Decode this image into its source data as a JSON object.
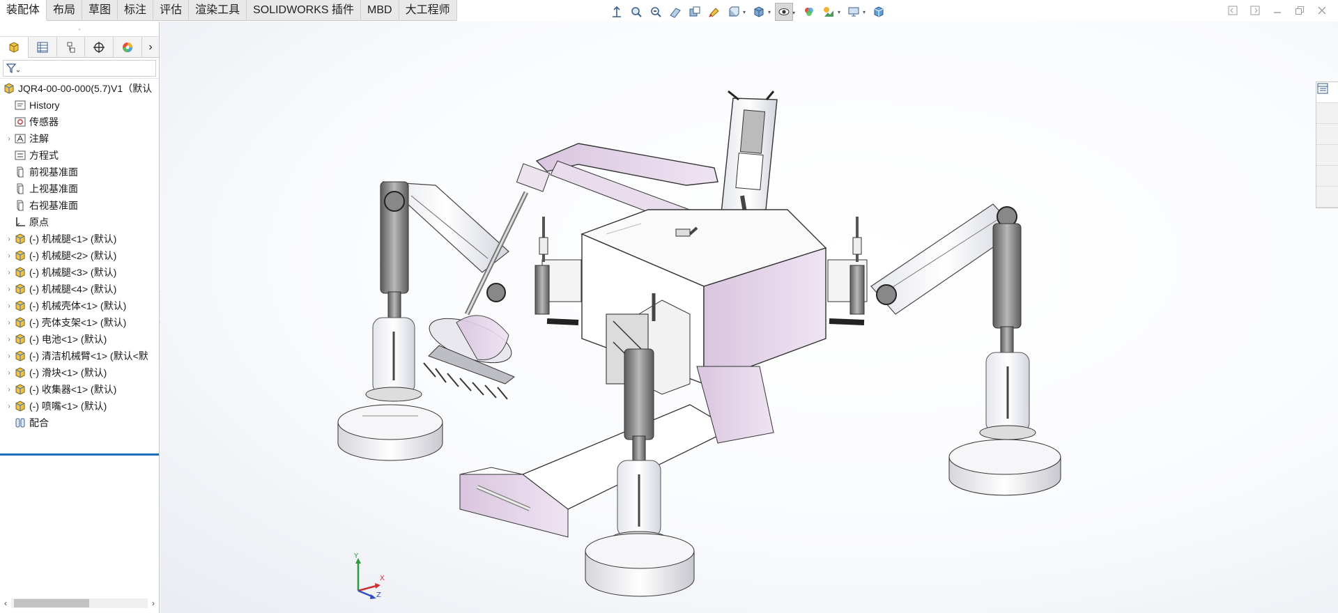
{
  "ribbon": {
    "tabs": [
      {
        "label": "装配体",
        "active": true
      },
      {
        "label": "布局",
        "active": false
      },
      {
        "label": "草图",
        "active": false
      },
      {
        "label": "标注",
        "active": false
      },
      {
        "label": "评估",
        "active": false
      },
      {
        "label": "渲染工具",
        "active": false
      },
      {
        "label": "SOLIDWORKS 插件",
        "active": false
      },
      {
        "label": "MBD",
        "active": false
      },
      {
        "label": "大工程师",
        "active": false
      }
    ]
  },
  "hud_icons": [
    "zoom-to-fit-icon",
    "zoom-to-area-icon",
    "previous-view-icon",
    "section-view-icon",
    "dynamic-annotation-icon",
    "rotate-view-icon",
    "view-orientation-icon",
    "display-style-icon",
    "hide-show-items-icon",
    "edit-appearance-icon",
    "apply-scene-icon",
    "view-settings-icon",
    "3d-view-icon"
  ],
  "feature_tree": {
    "root_label": "JQR4-00-00-000(5.7)V1（默认",
    "items": [
      {
        "label": "History",
        "icon": "history-icon",
        "expandable": false
      },
      {
        "label": "传感器",
        "icon": "sensor-icon",
        "expandable": false
      },
      {
        "label": "注解",
        "icon": "annotation-icon",
        "expandable": true
      },
      {
        "label": "方程式",
        "icon": "equation-icon",
        "expandable": false
      },
      {
        "label": "前视基准面",
        "icon": "plane-icon",
        "expandable": false
      },
      {
        "label": "上视基准面",
        "icon": "plane-icon",
        "expandable": false
      },
      {
        "label": "右视基准面",
        "icon": "plane-icon",
        "expandable": false
      },
      {
        "label": "原点",
        "icon": "origin-icon",
        "expandable": false
      },
      {
        "label": "(-) 机械腿<1> (默认)",
        "icon": "subassembly-icon",
        "expandable": true
      },
      {
        "label": "(-) 机械腿<2> (默认)",
        "icon": "subassembly-icon",
        "expandable": true
      },
      {
        "label": "(-) 机械腿<3> (默认)",
        "icon": "subassembly-icon",
        "expandable": true
      },
      {
        "label": "(-) 机械腿<4> (默认)",
        "icon": "subassembly-icon",
        "expandable": true
      },
      {
        "label": "(-) 机械壳体<1> (默认)",
        "icon": "subassembly-icon",
        "expandable": true
      },
      {
        "label": "(-) 壳体支架<1> (默认)",
        "icon": "subassembly-icon",
        "expandable": true
      },
      {
        "label": "(-) 电池<1> (默认)",
        "icon": "subassembly-icon",
        "expandable": true
      },
      {
        "label": "(-) 清洁机械臂<1> (默认<默",
        "icon": "subassembly-icon",
        "expandable": true
      },
      {
        "label": "(-) 滑块<1> (默认)",
        "icon": "subassembly-icon",
        "expandable": true
      },
      {
        "label": "(-) 收集器<1> (默认)",
        "icon": "subassembly-icon",
        "expandable": true
      },
      {
        "label": "(-) 喷嘴<1> (默认)",
        "icon": "subassembly-icon",
        "expandable": true
      },
      {
        "label": "配合",
        "icon": "mates-icon",
        "expandable": false
      }
    ]
  },
  "triad": {
    "x": "X",
    "y": "Y",
    "z": "Z"
  },
  "colors": {
    "accent": "#1e6fb8",
    "part_lilac": "#e6d7ea",
    "part_grey": "#7d7d7d"
  }
}
